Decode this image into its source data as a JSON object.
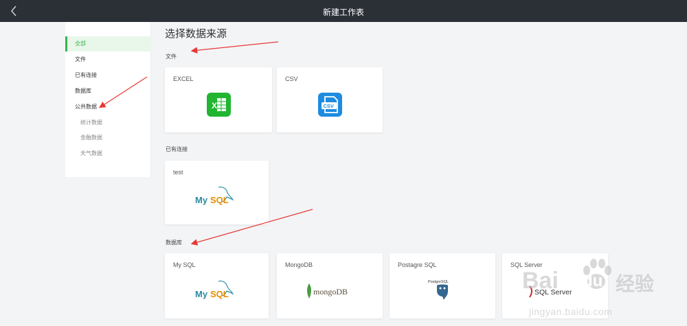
{
  "header": {
    "title": "新建工作表",
    "back_icon": "chevron-left-icon"
  },
  "sidebar": {
    "items": [
      {
        "label": "全部",
        "active": true
      },
      {
        "label": "文件"
      },
      {
        "label": "已有连接"
      },
      {
        "label": "数据库"
      },
      {
        "label": "公共数据"
      },
      {
        "label": "统计数据",
        "sub": true
      },
      {
        "label": "金融数据",
        "sub": true
      },
      {
        "label": "天气数据",
        "sub": true
      }
    ]
  },
  "main": {
    "title": "选择数据来源",
    "sections": {
      "files": {
        "label": "文件",
        "cards": [
          {
            "label": "EXCEL",
            "icon": "excel-icon",
            "color": "#21b531"
          },
          {
            "label": "CSV",
            "icon": "csv-icon",
            "color": "#1d8ce0"
          }
        ]
      },
      "connections": {
        "label": "已有连接",
        "cards": [
          {
            "label": "test",
            "logo_text_a": "My",
            "logo_text_b": "SQL"
          }
        ]
      },
      "databases": {
        "label": "数据库",
        "cards": [
          {
            "label": "My SQL",
            "logo_text_a": "My",
            "logo_text_b": "SQL"
          },
          {
            "label": "MongoDB",
            "logo_text": "mongoDB"
          },
          {
            "label": "Postagre SQL",
            "logo_text": "PostgreSQL"
          },
          {
            "label": "SQL Server",
            "logo_text": "SQL Server"
          }
        ]
      }
    }
  },
  "watermark": {
    "brand_a": "Bai",
    "brand_b": "du",
    "brand_cn": "经验",
    "url": "jingyan.baidu.com"
  },
  "colors": {
    "accent": "#35b44a",
    "annotation_arrow": "#e53935",
    "topbar": "#2b2f36"
  }
}
